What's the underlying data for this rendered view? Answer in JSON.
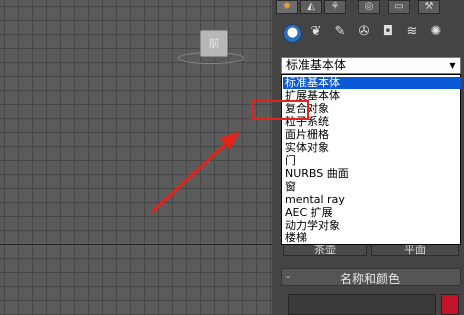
{
  "viewport": {
    "viewcube_label": "前"
  },
  "command_panel": {
    "top_tabs": [
      {
        "icon": "create-tab-icon",
        "glyph": "✸"
      },
      {
        "icon": "modify-tab-icon",
        "glyph": "◭"
      },
      {
        "icon": "hierarchy-tab-icon",
        "glyph": "⚘"
      },
      {
        "icon": "motion-tab-icon",
        "glyph": "◎"
      },
      {
        "icon": "display-tab-icon",
        "glyph": "▭"
      },
      {
        "icon": "utilities-tab-icon",
        "glyph": "⚒"
      }
    ],
    "sub_icons": [
      {
        "icon": "geometry-icon",
        "glyph": "●"
      },
      {
        "icon": "shapes-icon",
        "glyph": "❦"
      },
      {
        "icon": "lights-icon",
        "glyph": "✎"
      },
      {
        "icon": "cameras-icon",
        "glyph": "✇"
      },
      {
        "icon": "helpers-icon",
        "glyph": "◘"
      },
      {
        "icon": "space-warps-icon",
        "glyph": "≋"
      },
      {
        "icon": "systems-icon",
        "glyph": "✺"
      }
    ],
    "category_dropdown": {
      "value": "标准基本体",
      "options": [
        "标准基本体",
        "扩展基本体",
        "复合对象",
        "粒子系统",
        "面片栅格",
        "实体对象",
        "门",
        "NURBS 曲面",
        "窗",
        "mental ray",
        "AEC 扩展",
        "动力学对象",
        "楼梯"
      ],
      "selected_index": 0,
      "highlighted_option": "复合对象"
    },
    "object_buttons": {
      "left_label": "茶壶",
      "right_label": "平面"
    },
    "name_color_rollout": {
      "sign": "-",
      "title": "名称和颜色",
      "name_value": "",
      "color": "#c4122a"
    }
  },
  "colors": {
    "selection": "#0a59d6",
    "annotation": "#e2231a"
  }
}
